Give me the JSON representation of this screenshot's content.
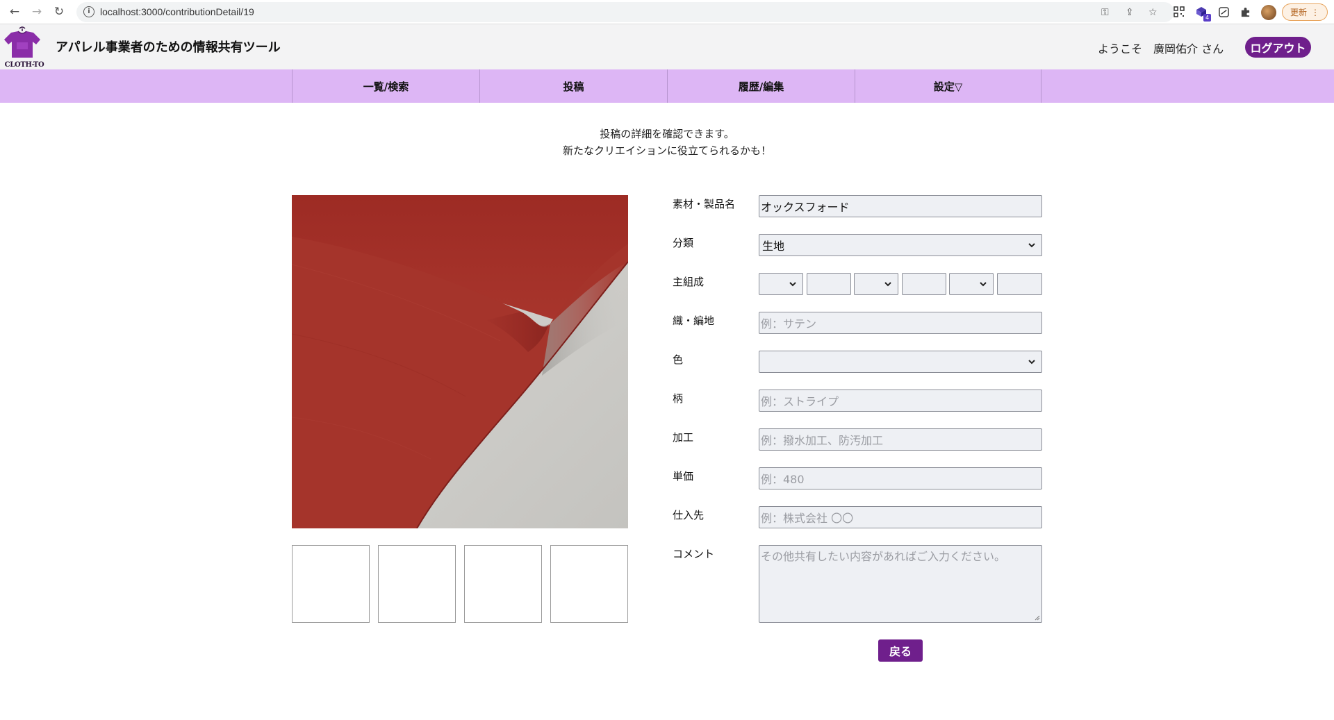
{
  "browser": {
    "url": "localhost:3000/contributionDetail/19",
    "update_label": "更新",
    "extension_badge": "4"
  },
  "header": {
    "logo_text": "CLOTH-TO",
    "site_title": "アパレル事業者のための情報共有ツール",
    "welcome": "ようこそ",
    "user_name": "廣岡佑介 さん",
    "logout_label": "ログアウト"
  },
  "nav": {
    "items": [
      {
        "label": "一覧/検索"
      },
      {
        "label": "投稿"
      },
      {
        "label": "履歴/編集"
      },
      {
        "label": "設定▽"
      }
    ]
  },
  "intro": {
    "line1": "投稿の詳細を確認できます。",
    "line2": "新たなクリエイションに役立てられるかも！"
  },
  "form": {
    "product_name": {
      "label": "素材・製品名",
      "value": "オックスフォード"
    },
    "category": {
      "label": "分類",
      "value": "生地"
    },
    "composition": {
      "label": "主組成"
    },
    "weave": {
      "label": "織・編地",
      "placeholder": "例：サテン"
    },
    "color": {
      "label": "色",
      "value": ""
    },
    "pattern": {
      "label": "柄",
      "placeholder": "例：ストライプ"
    },
    "processing": {
      "label": "加工",
      "placeholder": "例：撥水加工、防汚加工"
    },
    "unit_price": {
      "label": "単価",
      "placeholder": "例：480"
    },
    "supplier": {
      "label": "仕入先",
      "placeholder": "例：株式会社 〇〇"
    },
    "comment": {
      "label": "コメント",
      "placeholder": "その他共有したい内容があればご入力ください。"
    },
    "back_label": "戻る"
  },
  "colors": {
    "brand_purple": "#6f1f8c",
    "nav_background": "#ddb6f5",
    "fabric_red": "#a6332a"
  }
}
